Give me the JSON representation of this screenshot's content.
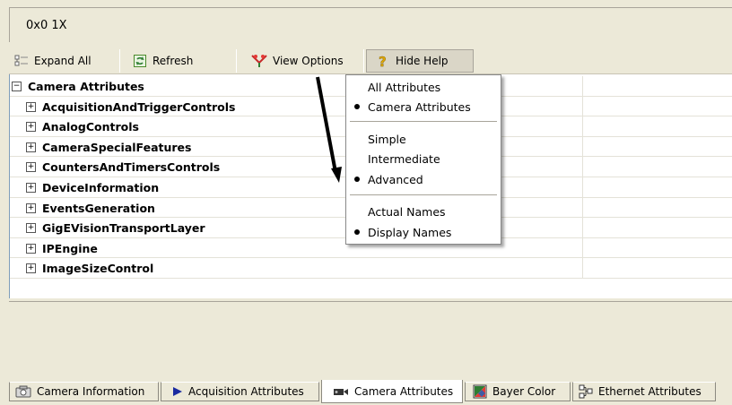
{
  "top_panel": {
    "text": "0x0  1X"
  },
  "toolbar": {
    "expand_all": "Expand All",
    "refresh": "Refresh",
    "view_options": "View Options",
    "hide_help": "Hide Help"
  },
  "tree": {
    "root": "Camera Attributes",
    "items": [
      "AcquisitionAndTriggerControls",
      "AnalogControls",
      "CameraSpecialFeatures",
      "CountersAndTimersControls",
      "DeviceInformation",
      "EventsGeneration",
      "GigEVisionTransportLayer",
      "IPEngine",
      "ImageSizeControl"
    ]
  },
  "menu": {
    "all_attributes": "All Attributes",
    "camera_attributes": "Camera Attributes",
    "simple": "Simple",
    "intermediate": "Intermediate",
    "advanced": "Advanced",
    "actual_names": "Actual Names",
    "display_names": "Display Names"
  },
  "tabs": {
    "camera_information": "Camera Information",
    "acquisition_attributes": "Acquisition Attributes",
    "camera_attributes": "Camera Attributes",
    "bayer_color": "Bayer Color",
    "ethernet_attributes": "Ethernet Attributes"
  }
}
